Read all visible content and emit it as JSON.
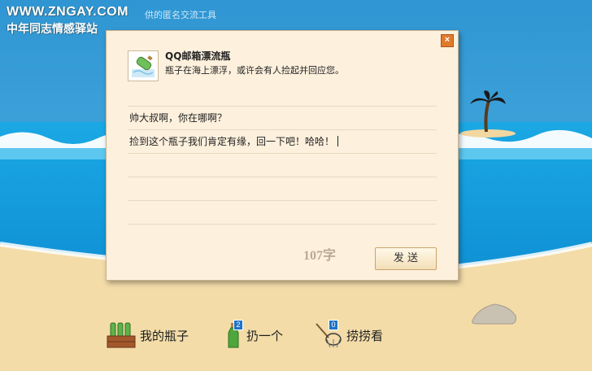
{
  "watermark": {
    "url": "WWW.ZNGAY.COM",
    "site_name": "中年同志情感驿站"
  },
  "top_tagline": "供的匿名交流工具",
  "dialog": {
    "close_glyph": "×",
    "title": "QQ邮箱漂流瓶",
    "subtitle": "瓶子在海上漂浮，或许会有人捡起并回应您。",
    "message_lines": [
      "帅大叔啊，你在哪啊？",
      "捡到这个瓶子我们肯定有缘，回一下吧！哈哈！",
      "",
      "",
      ""
    ],
    "char_count": "107字",
    "send_label": "发 送"
  },
  "actions": {
    "my_bottles": {
      "label": "我的瓶子",
      "icon": "bottle-crate-icon"
    },
    "throw_one": {
      "label": "扔一个",
      "icon": "bottle-icon",
      "badge": "2"
    },
    "fish": {
      "label": "捞捞看",
      "icon": "fishing-net-icon",
      "badge": "0"
    }
  },
  "colors": {
    "sky": "#3aa0d8",
    "sea": "#1fb0e6",
    "sand": "#f3dca8",
    "dialog_bg": "#fdf0dd",
    "accent_orange": "#e07a2a",
    "badge_blue": "#1e73c8"
  }
}
